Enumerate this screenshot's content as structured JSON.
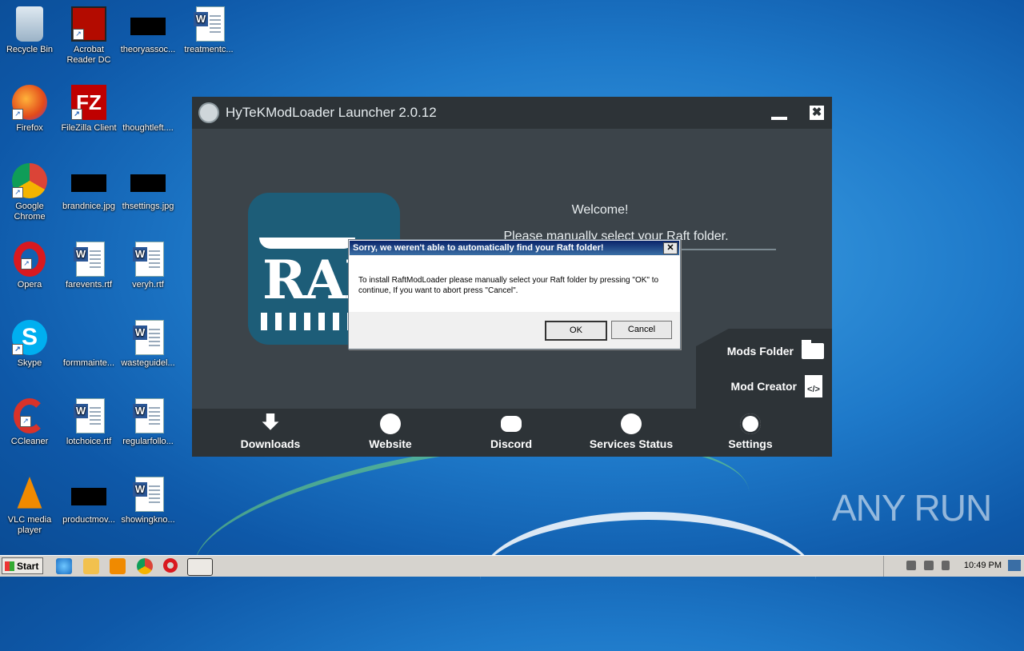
{
  "desktop": {
    "icons": [
      {
        "label": "Recycle Bin"
      },
      {
        "label": "Acrobat Reader DC"
      },
      {
        "label": "theoryassoc..."
      },
      {
        "label": "treatmentc..."
      },
      {
        "label": "Firefox"
      },
      {
        "label": "FileZilla Client"
      },
      {
        "label": "thoughtleft...."
      },
      {
        "label": "Google Chrome"
      },
      {
        "label": "brandnice.jpg"
      },
      {
        "label": "thsettings.jpg"
      },
      {
        "label": "Opera"
      },
      {
        "label": "farevents.rtf"
      },
      {
        "label": "veryh.rtf"
      },
      {
        "label": "Skype"
      },
      {
        "label": "formmainte..."
      },
      {
        "label": "wasteguidel..."
      },
      {
        "label": "CCleaner"
      },
      {
        "label": "lotchoice.rtf"
      },
      {
        "label": "regularfollo..."
      },
      {
        "label": "VLC media player"
      },
      {
        "label": "productmov..."
      },
      {
        "label": "showingkno..."
      }
    ],
    "watermark": "ANY RUN"
  },
  "launcher": {
    "title": "HyTeKModLoader Launcher 2.0.12",
    "minimize": "",
    "close": "✖",
    "logo_text": "RAFT",
    "welcome": "Welcome!",
    "prompt": "Please manually select your Raft folder.",
    "side": {
      "mods_folder": "Mods Folder",
      "mod_creator": "Mod Creator",
      "code_glyph": "</>"
    },
    "bottom": [
      {
        "label": "Downloads"
      },
      {
        "label": "Website"
      },
      {
        "label": "Discord"
      },
      {
        "label": "Services Status"
      },
      {
        "label": "Settings"
      }
    ]
  },
  "dialog": {
    "title": "Sorry, we weren't able to automatically find your Raft folder!",
    "close": "✕",
    "message": "To install RaftModLoader please manually select your Raft folder by pressing \"OK\" to continue, If you want to abort press \"Cancel\".",
    "ok": "OK",
    "cancel": "Cancel"
  },
  "taskbar": {
    "start": "Start",
    "clock": "10:49 PM"
  }
}
